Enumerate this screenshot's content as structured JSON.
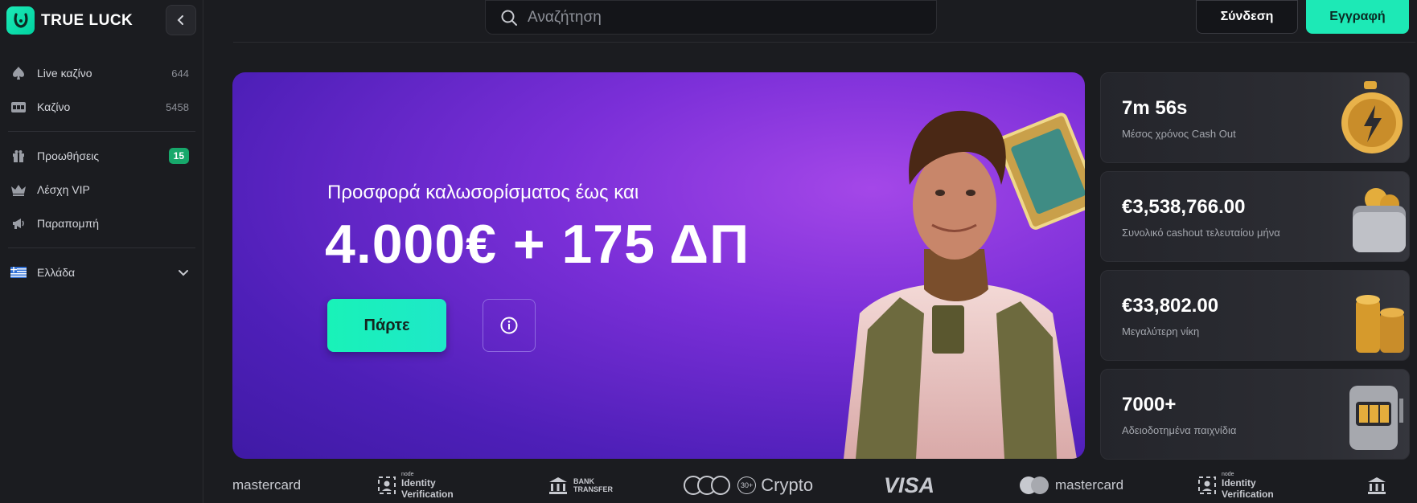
{
  "brand": {
    "name": "TRUE LUCK",
    "accent": "#1de9b6"
  },
  "sidebar": {
    "items": [
      {
        "label": "Live καζίνο",
        "count": "644",
        "icon": "spade-icon"
      },
      {
        "label": "Καζίνο",
        "count": "5458",
        "icon": "slot-machine-icon"
      },
      {
        "label": "Προωθήσεις",
        "badge": "15",
        "icon": "gift-icon"
      },
      {
        "label": "Λέσχη VIP",
        "icon": "crown-icon"
      },
      {
        "label": "Παραπομπή",
        "icon": "megaphone-icon"
      }
    ],
    "language": {
      "label": "Ελλάδα",
      "icon": "greek-flag-icon"
    }
  },
  "header": {
    "search_placeholder": "Αναζήτηση",
    "login_label": "Σύνδεση",
    "register_label": "Εγγραφή"
  },
  "hero": {
    "subtitle": "Προσφορά καλωσορίσματος έως και",
    "title": "4.000€ + 175 ΔΠ",
    "cta_label": "Πάρτε"
  },
  "stats": [
    {
      "value": "7m 56s",
      "label": "Μέσος χρόνος Cash Out",
      "icon": "stopwatch-icon"
    },
    {
      "value": "€3,538,766.00",
      "label": "Συνολικό cashout τελευταίου μήνα",
      "icon": "wallet-icon"
    },
    {
      "value": "€33,802.00",
      "label": "Μεγαλύτερη νίκη",
      "icon": "coins-icon"
    },
    {
      "value": "7000+",
      "label": "Αδειοδοτημένα παιχνίδια",
      "icon": "slot-machine-icon"
    }
  ],
  "payments": {
    "mastercard_1": "mastercard",
    "identity_1_top": "node",
    "identity_1_a": "Identity",
    "identity_1_b": "Verification",
    "bank_a": "BANK",
    "bank_b": "TRANSFER",
    "crypto": "Crypto",
    "crypto_more": "30+",
    "visa": "VISA",
    "mastercard_2": "mastercard",
    "identity_2_top": "node",
    "identity_2_a": "Identity",
    "identity_2_b": "Verification"
  }
}
